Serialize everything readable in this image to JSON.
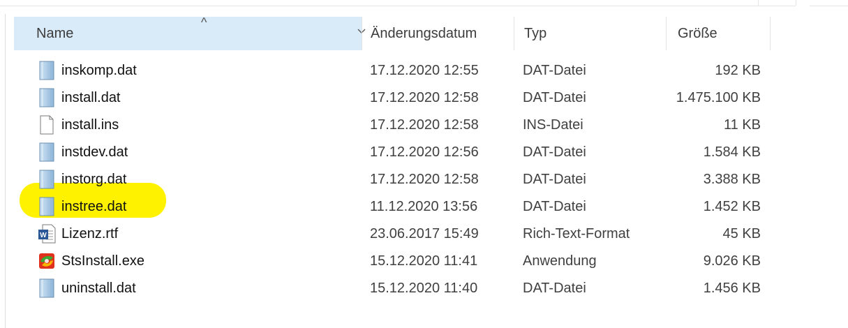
{
  "columns": {
    "name": "Name",
    "date": "Änderungsdatum",
    "type": "Typ",
    "size": "Größe"
  },
  "sort_indicator": "^",
  "dropdown_glyph": "⌄",
  "files": [
    {
      "name": "inskomp.dat",
      "date": "17.12.2020 12:55",
      "type": "DAT-Datei",
      "size": "192 KB",
      "icon": "dat-file-icon"
    },
    {
      "name": "install.dat",
      "date": "17.12.2020 12:58",
      "type": "DAT-Datei",
      "size": "1.475.100 KB",
      "icon": "dat-file-icon"
    },
    {
      "name": "install.ins",
      "date": "17.12.2020 12:58",
      "type": "INS-Datei",
      "size": "11 KB",
      "icon": "blank-file-icon"
    },
    {
      "name": "instdev.dat",
      "date": "17.12.2020 12:56",
      "type": "DAT-Datei",
      "size": "1.584 KB",
      "icon": "dat-file-icon"
    },
    {
      "name": "instorg.dat",
      "date": "17.12.2020 12:58",
      "type": "DAT-Datei",
      "size": "3.388 KB",
      "icon": "dat-file-icon"
    },
    {
      "name": "instree.dat",
      "date": "11.12.2020 13:56",
      "type": "DAT-Datei",
      "size": "1.452 KB",
      "icon": "dat-file-icon"
    },
    {
      "name": "Lizenz.rtf",
      "date": "23.06.2017 15:49",
      "type": "Rich-Text-Format",
      "size": "45 KB",
      "icon": "word-document-icon"
    },
    {
      "name": "StsInstall.exe",
      "date": "15.12.2020 11:41",
      "type": "Anwendung",
      "size": "9.026 KB",
      "icon": "application-icon"
    },
    {
      "name": "uninstall.dat",
      "date": "15.12.2020 11:40",
      "type": "DAT-Datei",
      "size": "1.456 KB",
      "icon": "dat-file-icon"
    }
  ],
  "colors": {
    "header_selected": "#d9ebf9",
    "highlight": "#fff200"
  }
}
